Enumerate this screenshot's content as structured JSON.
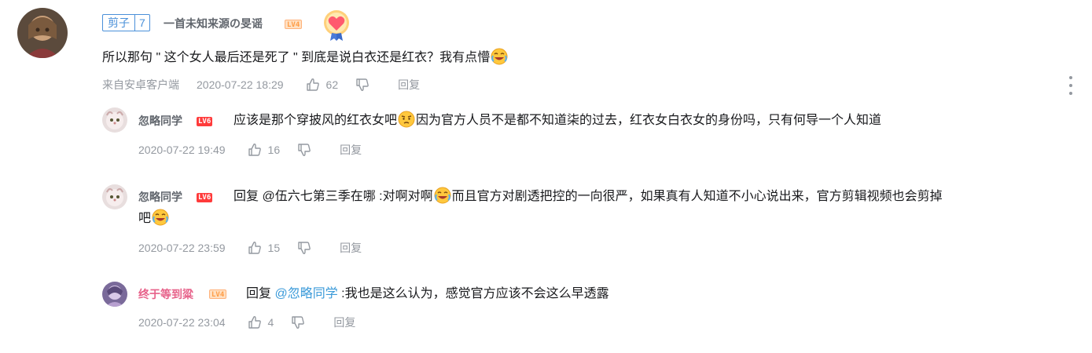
{
  "main_comment": {
    "badge_name": "剪子",
    "badge_level": "7",
    "username": "一首未知来源の旻谣",
    "user_level": "LV4",
    "content_text": "所以那句 \" 这个女人最后还是死了 \" 到底是说白衣还是红衣？我有点懵",
    "source": "来自安卓客户端",
    "time": "2020-07-22 18:29",
    "likes": "62",
    "reply_label": "回复"
  },
  "replies": [
    {
      "username": "忽略同学",
      "user_level": "LV6",
      "content_part1": "应该是那个穿披风的红衣女吧",
      "content_part2": "因为官方人员不是都不知道柒的过去，红衣女白衣女的身份吗，只有何导一个人知道",
      "time": "2020-07-22 19:49",
      "likes": "16",
      "reply_label": "回复"
    },
    {
      "username": "忽略同学",
      "user_level": "LV6",
      "content_part1": "回复 @伍六七第三季在哪 :对啊对啊",
      "content_part2": "而且官方对剧透把控的一向很严，如果真有人知道不小心说出来，官方剪辑视频也会剪掉",
      "content_part3": "吧",
      "time": "2020-07-22 23:59",
      "likes": "15",
      "reply_label": "回复"
    },
    {
      "username": "终于等到粱",
      "user_level": "LV4",
      "content_prefix": "回复 ",
      "content_mention": "@忽略同学",
      "content_suffix": " :我也是这么认为，感觉官方应该不会这么早透露",
      "time": "2020-07-22 23:04",
      "likes": "4",
      "reply_label": "回复"
    }
  ],
  "icons": {
    "like": "thumbs-up-icon",
    "dislike": "thumbs-down-icon",
    "more": "more-vertical-icon",
    "medal": "heart-medal-icon",
    "emoji_laugh_cry": "laugh-cry-emoji",
    "emoji_thinking": "thinking-emoji"
  },
  "colors": {
    "badge_blue": "#4a90d9",
    "mention_blue": "#3a9ad9",
    "username_gray": "#61666d",
    "username_pink": "#e7628a",
    "meta_gray": "#9499a0",
    "lv6_red": "#ff3b3b",
    "lv4_orange": "#ff9c45"
  }
}
